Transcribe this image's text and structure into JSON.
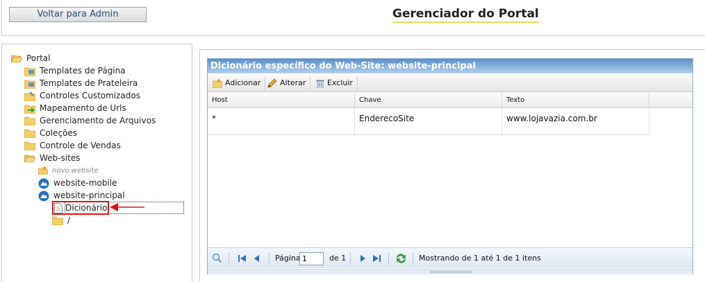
{
  "header": {
    "back_button_label": "Voltar para Admin",
    "title": "Gerenciador do Portal"
  },
  "tree": {
    "root": "Portal",
    "items": [
      {
        "label": "Templates de Página",
        "icon": "template-icon"
      },
      {
        "label": "Templates de Prateleira",
        "icon": "template-icon"
      },
      {
        "label": "Controles Customizados",
        "icon": "controls-icon"
      },
      {
        "label": "Mapeamento de Urls",
        "icon": "url-map-icon"
      },
      {
        "label": "Gerenciamento de Arquivos",
        "icon": "folder-icon"
      },
      {
        "label": "Coleções",
        "icon": "folder-icon"
      },
      {
        "label": "Controle de Vendas",
        "icon": "folder-icon"
      },
      {
        "label": "Web-sites",
        "icon": "folder-open-icon"
      }
    ],
    "websites": {
      "new": "novo website",
      "sites": [
        "website-mobile",
        "website-principal"
      ],
      "children": [
        "Dicionário",
        "/"
      ]
    }
  },
  "grid": {
    "title": "Dicionário específico do Web-Site: website-principal",
    "toolbar": {
      "add": "Adicionar",
      "edit": "Alterar",
      "delete": "Excluir"
    },
    "columns": [
      "Host",
      "Chave",
      "Texto"
    ],
    "rows": [
      [
        "*",
        "EnderecoSite",
        "www.lojavazia.com.br"
      ]
    ],
    "pager": {
      "page_label": "Página",
      "page_value": "1",
      "of_label": "de 1",
      "status": "Mostrando de 1 até 1 de 1 itens"
    }
  },
  "colors": {
    "title_bar": "#6a9bd0",
    "highlight_red": "#d8141a",
    "title_underline": "#f0d85a"
  }
}
